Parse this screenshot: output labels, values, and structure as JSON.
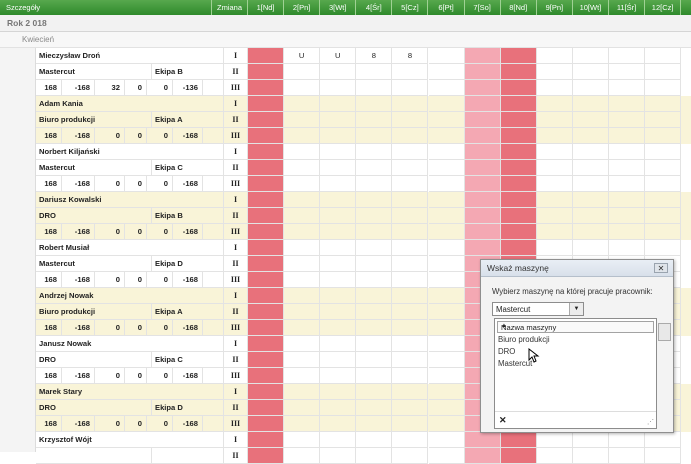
{
  "header": {
    "details_label": "Szczegóły",
    "shift_label": "Zmiana",
    "days": [
      "1[Nd]",
      "2[Pn]",
      "3[Wt]",
      "4[Śr]",
      "5[Cz]",
      "6[Pt]",
      "7[So]",
      "8[Nd]",
      "9[Pn]",
      "10[Wt]",
      "11[Śr]",
      "12[Cz]"
    ]
  },
  "year_label": "Rok 2 018",
  "month_label": "Kwiecień",
  "colors": {
    "header_green": "#3a9336",
    "holiday_red": "#e8717b",
    "saturday_pink": "#f4a8b3",
    "stripe_yellow": "#f9f4d8"
  },
  "employees": [
    {
      "name": "Mieczysław Droń",
      "machine": "Mastercut",
      "crew": "Ekipa B",
      "stats": [
        "168",
        "-168",
        "32",
        "0",
        "0",
        "-136"
      ],
      "days": [
        "",
        "U",
        "U",
        "8",
        "8",
        "",
        "",
        "",
        "",
        "",
        "",
        ""
      ]
    },
    {
      "name": "Adam Kania",
      "machine": "Biuro produkcji",
      "crew": "Ekipa A",
      "stats": [
        "168",
        "-168",
        "0",
        "0",
        "0",
        "-168"
      ],
      "days": [
        "",
        "",
        "",
        "",
        "",
        "",
        "",
        "",
        "",
        "",
        "",
        ""
      ]
    },
    {
      "name": "Norbert Kiljański",
      "machine": "Mastercut",
      "crew": "Ekipa C",
      "stats": [
        "168",
        "-168",
        "0",
        "0",
        "0",
        "-168"
      ],
      "days": [
        "",
        "",
        "",
        "",
        "",
        "",
        "",
        "",
        "",
        "",
        "",
        ""
      ]
    },
    {
      "name": "Dariusz Kowalski",
      "machine": "DRO",
      "crew": "Ekipa B",
      "stats": [
        "168",
        "-168",
        "0",
        "0",
        "0",
        "-168"
      ],
      "days": [
        "",
        "",
        "",
        "",
        "",
        "",
        "",
        "",
        "",
        "",
        "",
        ""
      ]
    },
    {
      "name": "Robert Musiał",
      "machine": "Mastercut",
      "crew": "Ekipa D",
      "stats": [
        "168",
        "-168",
        "0",
        "0",
        "0",
        "-168"
      ],
      "days": [
        "",
        "",
        "",
        "",
        "",
        "",
        "",
        "",
        "",
        "",
        "",
        ""
      ]
    },
    {
      "name": "Andrzej Nowak",
      "machine": "Biuro produkcji",
      "crew": "Ekipa A",
      "stats": [
        "168",
        "-168",
        "0",
        "0",
        "0",
        "-168"
      ],
      "days": [
        "",
        "",
        "",
        "",
        "",
        "",
        "",
        "",
        "",
        "",
        "",
        ""
      ]
    },
    {
      "name": "Janusz Nowak",
      "machine": "DRO",
      "crew": "Ekipa C",
      "stats": [
        "168",
        "-168",
        "0",
        "0",
        "0",
        "-168"
      ],
      "days": [
        "",
        "",
        "",
        "",
        "",
        "",
        "",
        "",
        "",
        "",
        "",
        ""
      ]
    },
    {
      "name": "Marek Stary",
      "machine": "DRO",
      "crew": "Ekipa D",
      "stats": [
        "168",
        "-168",
        "0",
        "0",
        "0",
        "-168"
      ],
      "days": [
        "",
        "",
        "",
        "",
        "",
        "",
        "",
        "",
        "",
        "",
        "",
        ""
      ]
    },
    {
      "name": "Krzysztof Wójt",
      "machine": "",
      "crew": "",
      "stats": [
        "",
        "",
        "",
        "",
        "",
        ""
      ],
      "days": [
        "",
        "",
        "",
        "",
        "",
        "",
        "",
        "",
        "",
        "",
        "",
        ""
      ]
    }
  ],
  "shifts": [
    "I",
    "II",
    "III"
  ],
  "dialog": {
    "title": "Wskaż maszynę",
    "prompt": "Wybierz maszynę na której pracuje pracownik:",
    "selected": "Mastercut",
    "list_header": "Nazwa maszyny",
    "options": [
      "Biuro produkcji",
      "DRO",
      "Mastercut"
    ],
    "close_glyph": "✕",
    "clear_glyph": "✕"
  }
}
